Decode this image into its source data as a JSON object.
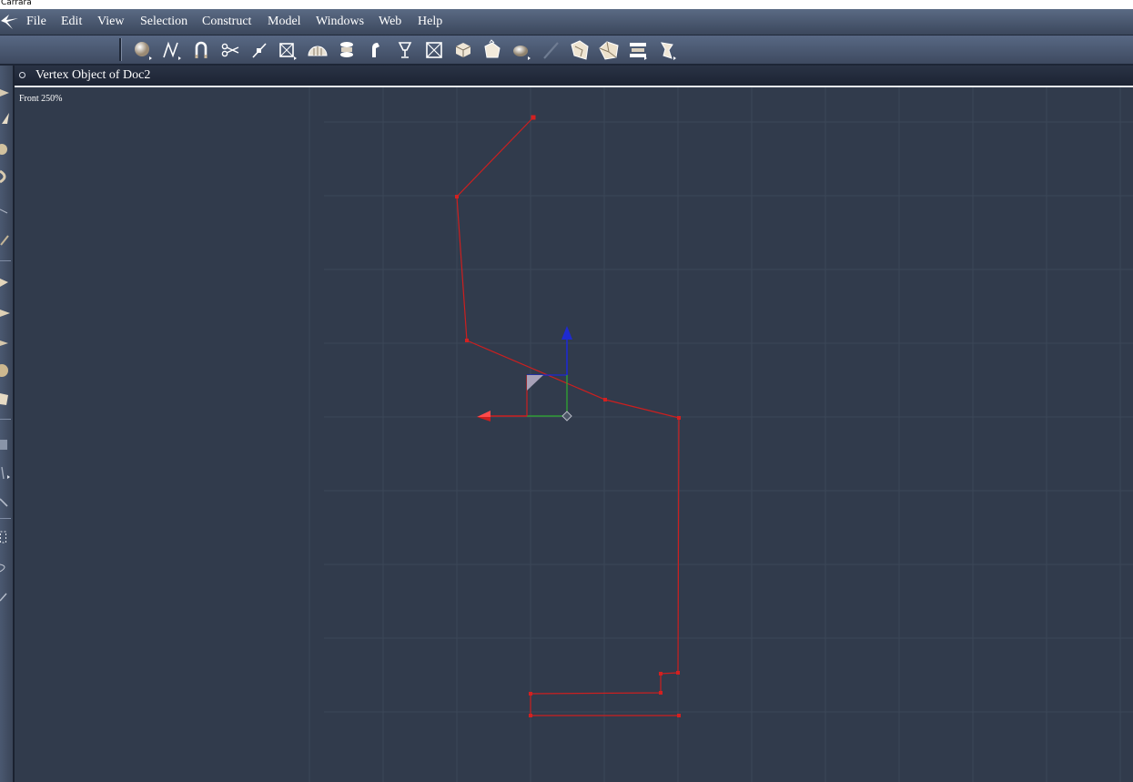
{
  "window": {
    "os_title": "Carrara"
  },
  "menubar": {
    "items": [
      "File",
      "Edit",
      "View",
      "Selection",
      "Construct",
      "Model",
      "Windows",
      "Web",
      "Help"
    ]
  },
  "toolbar": {
    "tools": [
      "sphere-primitive-icon",
      "spline-icon",
      "magnet-icon",
      "scissors-icon",
      "vertex-pen-icon",
      "box-primitive-icon",
      "dome-icon",
      "lathe-icon",
      "sweep-icon",
      "goblet-icon",
      "flatten-icon",
      "extrude-block-icon",
      "fill-icon",
      "sphere-brush-icon",
      "pencil-icon",
      "shape-tool-1-icon",
      "shape-tool-2-icon",
      "shape-tool-3-icon",
      "shape-tool-4-icon"
    ]
  },
  "document": {
    "title": "Vertex Object of Doc2",
    "view_label": "Front 250%"
  },
  "colors": {
    "accent_red": "#cc1f1f",
    "gizmo_blue": "#1e2ad0",
    "gizmo_green": "#2fae2f",
    "grid": "#3c4758",
    "background": "#313b4c"
  }
}
